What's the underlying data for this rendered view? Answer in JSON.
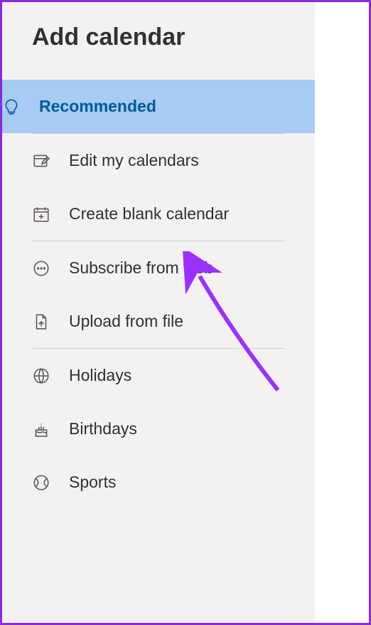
{
  "header": {
    "title": "Add calendar"
  },
  "menu": {
    "recommended": {
      "label": "Recommended"
    },
    "edit": {
      "label": "Edit my calendars"
    },
    "create": {
      "label": "Create blank calendar"
    },
    "subscribe": {
      "label": "Subscribe from web"
    },
    "upload": {
      "label": "Upload from file"
    },
    "holidays": {
      "label": "Holidays"
    },
    "birthdays": {
      "label": "Birthdays"
    },
    "sports": {
      "label": "Sports"
    }
  }
}
